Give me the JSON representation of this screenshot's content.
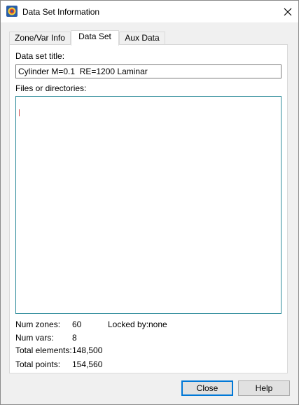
{
  "window": {
    "title": "Data Set Information",
    "icon": "tecplot-app-icon",
    "close_icon": "close-icon"
  },
  "tabs": [
    {
      "label": "Zone/Var Info",
      "active": false
    },
    {
      "label": "Data Set",
      "active": true
    },
    {
      "label": "Aux Data",
      "active": false
    }
  ],
  "dataset": {
    "title_label": "Data set title:",
    "title_value": "Cylinder M=0.1  RE=1200 Laminar",
    "files_label": "Files or directories:"
  },
  "stats": {
    "num_zones_label": "Num zones:",
    "num_zones_value": "60",
    "locked_by_label": "Locked by:",
    "locked_by_value": "none",
    "num_vars_label": "Num vars:",
    "num_vars_value": "8",
    "total_elements_label": "Total elements:",
    "total_elements_value": "148,500",
    "total_points_label": "Total points:",
    "total_points_value": "154,560"
  },
  "buttons": {
    "close_label": "Close",
    "help_label": "Help"
  },
  "colors": {
    "accent": "#0078d7",
    "files_border": "#2e8b9a"
  }
}
